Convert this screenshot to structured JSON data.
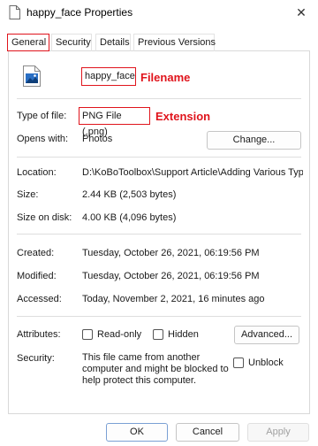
{
  "window": {
    "title": "happy_face Properties",
    "close_glyph": "✕"
  },
  "tabs": [
    {
      "label": "General",
      "active": true
    },
    {
      "label": "Security"
    },
    {
      "label": "Details"
    },
    {
      "label": "Previous Versions"
    }
  ],
  "file": {
    "icon": "image-file-icon",
    "name": "happy_face"
  },
  "annotations": {
    "filename": "Filename",
    "extension": "Extension"
  },
  "properties": {
    "type_label": "Type of file:",
    "type_value": "PNG File (.png)",
    "opens_label": "Opens with:",
    "opens_value": "Photos",
    "change_button": "Change...",
    "location_label": "Location:",
    "location_value": "D:\\KoBoToolbox\\Support Article\\Adding Various Typ",
    "size_label": "Size:",
    "size_value": "2.44 KB (2,503 bytes)",
    "size_disk_label": "Size on disk:",
    "size_disk_value": "4.00 KB (4,096 bytes)",
    "created_label": "Created:",
    "created_value": "Tuesday, October 26, 2021, 06:19:56 PM",
    "modified_label": "Modified:",
    "modified_value": "Tuesday, October 26, 2021, 06:19:56 PM",
    "accessed_label": "Accessed:",
    "accessed_value": "Today, November 2, 2021, 16 minutes ago",
    "attributes_label": "Attributes:",
    "readonly_label": "Read-only",
    "hidden_label": "Hidden",
    "advanced_button": "Advanced...",
    "security_label": "Security:",
    "security_text": "This file came from another computer and might be blocked to help protect this computer.",
    "unblock_label": "Unblock"
  },
  "buttons": {
    "ok": "OK",
    "cancel": "Cancel",
    "apply": "Apply"
  },
  "colors": {
    "annotation_red": "#e0141c",
    "ok_border": "#7aa0d4"
  }
}
